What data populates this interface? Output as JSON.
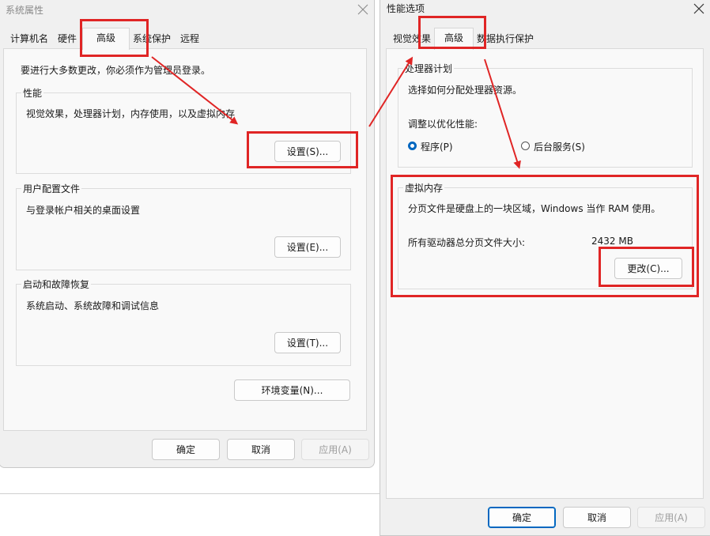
{
  "sys_props": {
    "title": "系统属性",
    "tabs": [
      "计算机名",
      "硬件",
      "高级",
      "系统保护",
      "远程"
    ],
    "admin_note": "要进行大多数更改，你必须作为管理员登录。",
    "performance": {
      "label": "性能",
      "desc": "视觉效果，处理器计划，内存使用，以及虚拟内存",
      "button": "设置(S)..."
    },
    "profiles": {
      "label": "用户配置文件",
      "desc": "与登录帐户相关的桌面设置",
      "button": "设置(E)..."
    },
    "startup": {
      "label": "启动和故障恢复",
      "desc": "系统启动、系统故障和调试信息",
      "button": "设置(T)..."
    },
    "env_button": "环境变量(N)...",
    "ok": "确定",
    "cancel": "取消",
    "apply": "应用(A)"
  },
  "perf_opts": {
    "title": "性能选项",
    "tabs": [
      "视觉效果",
      "高级",
      "数据执行保护"
    ],
    "cpu": {
      "label": "处理器计划",
      "desc": "选择如何分配处理器资源。",
      "adjust": "调整以优化性能:",
      "radio_programs": "程序(P)",
      "radio_services": "后台服务(S)"
    },
    "vm": {
      "label": "虚拟内存",
      "desc": "分页文件是硬盘上的一块区域，Windows 当作 RAM 使用。",
      "total_label": "所有驱动器总分页文件大小:",
      "total_value": "2432 MB",
      "change_button": "更改(C)..."
    },
    "ok": "确定",
    "cancel": "取消",
    "apply": "应用(A)"
  },
  "colors": {
    "annotation": "#e02525",
    "accent": "#0067c0"
  }
}
